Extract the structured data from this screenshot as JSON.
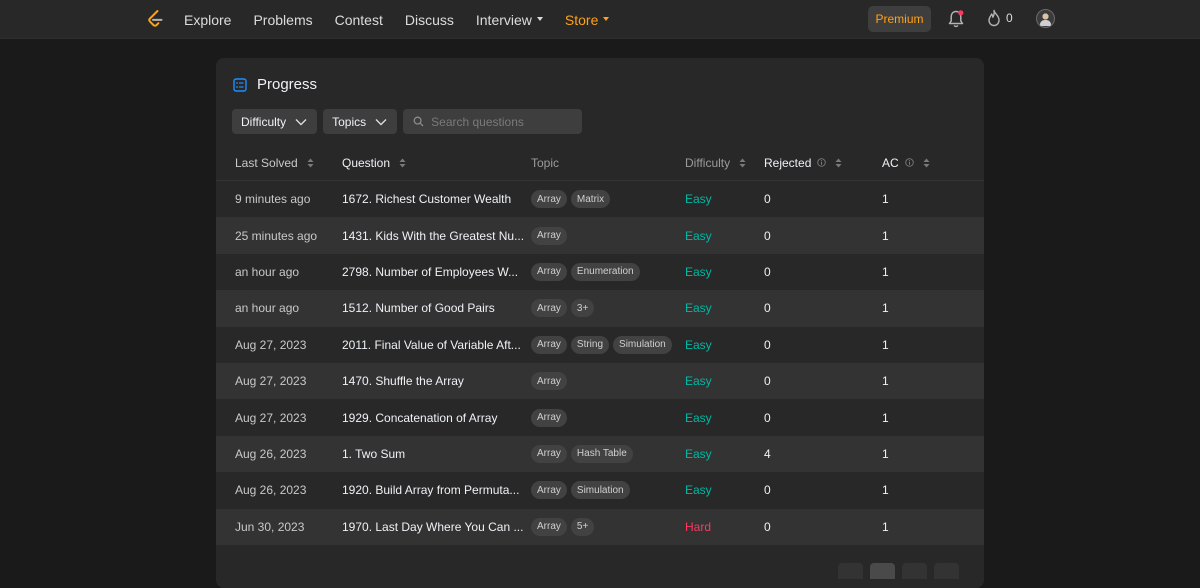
{
  "nav": {
    "links": [
      "Explore",
      "Problems",
      "Contest",
      "Discuss",
      "Interview",
      "Store"
    ],
    "premium_label": "Premium",
    "streak_count": "0",
    "accent": "#ffa116"
  },
  "progress": {
    "title": "Progress",
    "filters": {
      "difficulty_label": "Difficulty",
      "topics_label": "Topics"
    },
    "search": {
      "placeholder": "Search questions",
      "value": ""
    },
    "columns": [
      "Last Solved",
      "Question",
      "Topic",
      "Difficulty",
      "Rejected",
      "AC"
    ],
    "rows": [
      {
        "last": "9 minutes ago",
        "question": "1672. Richest Customer Wealth",
        "tags": [
          "Array",
          "Matrix"
        ],
        "difficulty": "Easy",
        "rejected": "0",
        "ac": "1"
      },
      {
        "last": "25 minutes ago",
        "question": "1431. Kids With the Greatest Nu...",
        "tags": [
          "Array"
        ],
        "difficulty": "Easy",
        "rejected": "0",
        "ac": "1"
      },
      {
        "last": "an hour ago",
        "question": "2798. Number of Employees W...",
        "tags": [
          "Array",
          "Enumeration"
        ],
        "difficulty": "Easy",
        "rejected": "0",
        "ac": "1"
      },
      {
        "last": "an hour ago",
        "question": "1512. Number of Good Pairs",
        "tags": [
          "Array",
          "3+"
        ],
        "difficulty": "Easy",
        "rejected": "0",
        "ac": "1"
      },
      {
        "last": "Aug 27, 2023",
        "question": "2011. Final Value of Variable Aft...",
        "tags": [
          "Array",
          "String",
          "Simulation"
        ],
        "difficulty": "Easy",
        "rejected": "0",
        "ac": "1"
      },
      {
        "last": "Aug 27, 2023",
        "question": "1470. Shuffle the Array",
        "tags": [
          "Array"
        ],
        "difficulty": "Easy",
        "rejected": "0",
        "ac": "1"
      },
      {
        "last": "Aug 27, 2023",
        "question": "1929. Concatenation of Array",
        "tags": [
          "Array"
        ],
        "difficulty": "Easy",
        "rejected": "0",
        "ac": "1"
      },
      {
        "last": "Aug 26, 2023",
        "question": "1. Two Sum",
        "tags": [
          "Array",
          "Hash Table"
        ],
        "difficulty": "Easy",
        "rejected": "4",
        "ac": "1"
      },
      {
        "last": "Aug 26, 2023",
        "question": "1920. Build Array from Permuta...",
        "tags": [
          "Array",
          "Simulation"
        ],
        "difficulty": "Easy",
        "rejected": "0",
        "ac": "1"
      },
      {
        "last": "Jun 30, 2023",
        "question": "1970. Last Day Where You Can ...",
        "tags": [
          "Array",
          "5+"
        ],
        "difficulty": "Hard",
        "rejected": "0",
        "ac": "1"
      }
    ],
    "colors": {
      "easy": "#00b8a3",
      "hard": "#ff375f"
    }
  }
}
